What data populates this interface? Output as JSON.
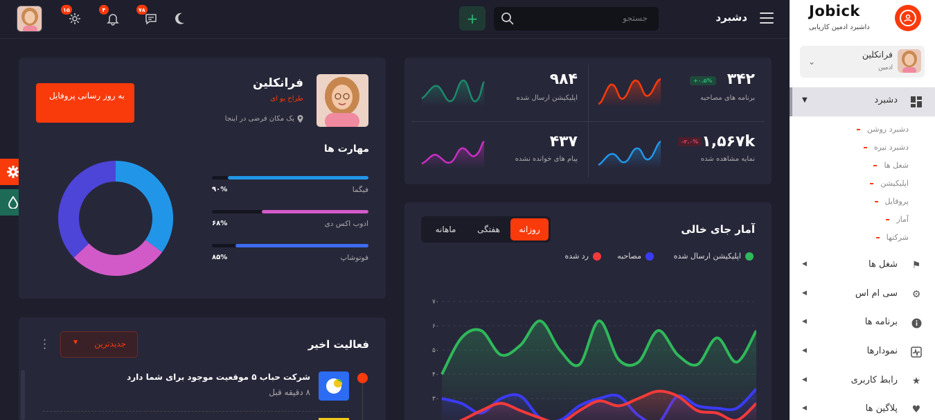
{
  "sidebar": {
    "brand": "Jobick",
    "brand_sub": "داشبرد ادمین کاریابی",
    "user_name": "فرانکلین",
    "user_role": "ادمین",
    "active_menu": "دشبرد",
    "submenu": [
      "دشبرد روشن",
      "دشبرد تیره",
      "شغل ها",
      "اپلیکیشن",
      "پروفایل",
      "آمار",
      "شرکتها"
    ],
    "menu": [
      {
        "label": "شغل ها",
        "icon": "briefcase-icon"
      },
      {
        "label": "سی ام اس",
        "icon": "gear-icon"
      },
      {
        "label": "برنامه ها",
        "icon": "info-icon"
      },
      {
        "label": "نمودارها",
        "icon": "pulse-icon"
      },
      {
        "label": "رابط کاربری",
        "icon": "star-icon"
      },
      {
        "label": "پلاگین ها",
        "icon": "heart-icon"
      }
    ],
    "accent": "#f93a0b"
  },
  "topbar": {
    "title": "دشبرد",
    "search_placeholder": "جستجو",
    "badges": {
      "messages": "۷۸",
      "notifications": "۴",
      "settings": "۱۵"
    }
  },
  "stats": [
    {
      "value": "۳۴۲",
      "label": "برنامه های مصاحبه",
      "pill": "+۰.۵%"
    },
    {
      "value": "۹۸۴",
      "label": "اپلیکیشن ارسال شده"
    },
    {
      "value": "۱,۵۶۷k",
      "label": "نمایه مشاهده شده",
      "pill": "-۲.۰%"
    },
    {
      "value": "۴۳۷",
      "label": "پیام های خوانده نشده"
    }
  ],
  "vacancy": {
    "title": "آمار جای خالی",
    "tabs": [
      "روزانه",
      "هفتگی",
      "ماهانه"
    ],
    "legend": [
      {
        "label": "اپلیکیشن ارسال شده",
        "color": "#2fb85a"
      },
      {
        "label": "مصاحبه",
        "color": "#3b3bf5"
      },
      {
        "label": "رد شده",
        "color": "#f23a3a"
      }
    ]
  },
  "chart_data": {
    "type": "line",
    "y_ticks": [
      "۷۰",
      "۶۰",
      "۵۰",
      "۴۰",
      "۳۰"
    ],
    "ylim": [
      20,
      70
    ],
    "x": [
      0,
      1,
      2,
      3,
      4,
      5,
      6,
      7,
      8,
      9,
      10,
      11,
      12,
      13,
      14,
      15,
      16
    ],
    "series": [
      {
        "name": "اپلیکیشن ارسال شده",
        "color": "#2fb85a",
        "values": [
          40,
          55,
          58,
          48,
          52,
          62,
          50,
          44,
          62,
          46,
          45,
          58,
          48,
          44,
          55,
          45,
          58
        ]
      },
      {
        "name": "مصاحبه",
        "color": "#3b3bf5",
        "values": [
          30,
          28,
          24,
          30,
          31,
          22,
          21,
          27,
          30,
          31,
          23,
          20,
          31,
          27,
          26,
          26,
          34
        ]
      },
      {
        "name": "رد شده",
        "color": "#f23a3a",
        "values": [
          18,
          21,
          25,
          28,
          25,
          22,
          20,
          25,
          29,
          27,
          30,
          33,
          31,
          25,
          24,
          21,
          28
        ]
      }
    ]
  },
  "profile": {
    "name": "فرانکلین",
    "role": "طراح یو ای",
    "location": "یک مکان فرضی در اینجا",
    "cta": "به روز رسانی پروفایل",
    "skills_title": "مهارت ها",
    "skills": [
      {
        "label": "فیگما",
        "pct": "۹۰%",
        "value": 0.9,
        "color": "#2196e8"
      },
      {
        "label": "ادوب اکس دی",
        "pct": "۶۸%",
        "value": 0.68,
        "color": "#d25ac8"
      },
      {
        "label": "فوتوشاپ",
        "pct": "۸۵%",
        "value": 0.85,
        "color": "#3d6cf2"
      }
    ],
    "donut": [
      {
        "label": "فیگما",
        "value": 35,
        "color": "#2196e8"
      },
      {
        "label": "ادوب اکس دی",
        "value": 28,
        "color": "#d25ac8"
      },
      {
        "label": "فوتوشاپ",
        "value": 37,
        "color": "#4d44d8"
      }
    ]
  },
  "activity": {
    "title": "فعالیت اخیر",
    "filter": "جدیدترین",
    "items": [
      {
        "title": "شرکت حباب ۵ موقعیت موجود برای شما دارد",
        "time": "۸ دقیقه قبل"
      }
    ]
  }
}
